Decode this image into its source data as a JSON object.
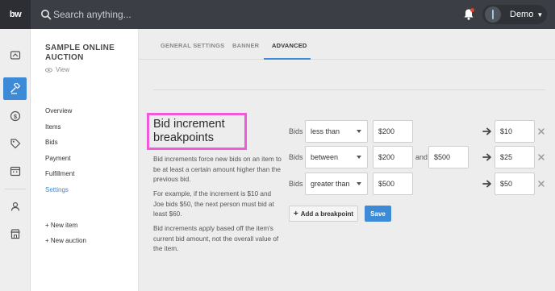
{
  "app": {
    "logo": "bw"
  },
  "search": {
    "placeholder": "Search anything..."
  },
  "user": {
    "name": "Demo"
  },
  "sidebar": {
    "title": "SAMPLE ONLINE AUCTION",
    "view_label": "View",
    "links": [
      "Overview",
      "Items",
      "Bids",
      "Payment",
      "Fulfillment",
      "Settings"
    ],
    "active_link": "Settings",
    "add_item": "+ New item",
    "add_auction": "+ New auction"
  },
  "tabs": [
    "GENERAL SETTINGS",
    "BANNER",
    "ADVANCED"
  ],
  "active_tab": "ADVANCED",
  "section": {
    "title": "Bid increment breakpoints",
    "paragraphs": [
      "Bid increments force new bids on an item to be at least a certain amount higher than the previous bid.",
      "For example, if the increment is $10 and Joe bids $50, the next person must bid at least $60.",
      "Bid increments apply based off the item's current bid amount, not the overall value of the item."
    ]
  },
  "breakpoints": [
    {
      "label": "Bids",
      "condition": "less than",
      "value1": "$200",
      "increment": "$10"
    },
    {
      "label": "Bids",
      "condition": "between",
      "value1": "$200",
      "and_label": "and",
      "value2": "$500",
      "increment": "$25"
    },
    {
      "label": "Bids",
      "condition": "greater than",
      "value1": "$500",
      "increment": "$50"
    }
  ],
  "buttons": {
    "add_breakpoint": "Add a breakpoint",
    "save": "Save"
  },
  "colors": {
    "accent": "#3d8ad6",
    "topbar": "#3b3e44",
    "highlight_box": "#f05ad8",
    "notification": "#e0432e"
  }
}
